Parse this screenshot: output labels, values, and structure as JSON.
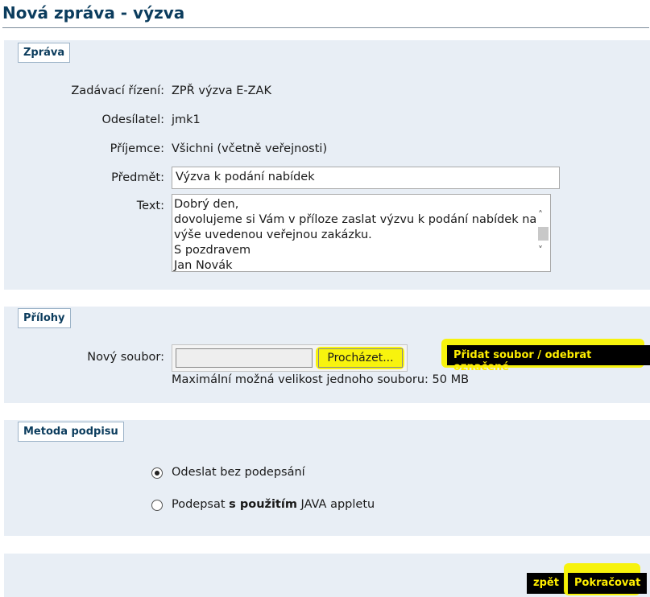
{
  "page": {
    "title": "Nová zpráva - výzva"
  },
  "message": {
    "legend": "Zpráva",
    "procedure_label": "Zadávací řízení:",
    "procedure_value": "ZPŘ výzva E-ZAK",
    "sender_label": "Odesílatel:",
    "sender_value": "jmk1",
    "recipient_label": "Příjemce:",
    "recipient_value": "Všichni (včetně veřejnosti)",
    "subject_label": "Předmět:",
    "subject_value": "Výzva k podání nabídek",
    "text_label": "Text:",
    "text_lines": [
      "Dobrý den,",
      "dovolujeme si Vám v příloze zaslat výzvu k podání nabídek na",
      "výše uvedenou veřejnou zakázku.",
      "S pozdravem",
      "Jan Novák"
    ]
  },
  "attachments": {
    "legend": "Přílohy",
    "new_file_label": "Nový soubor:",
    "browse_button": "Procházet...",
    "add_remove_button": "Přidat soubor / odebrat označené",
    "max_size_note": "Maximální možná velikost jednoho souboru: 50 MB"
  },
  "signature": {
    "legend": "Metoda podpisu",
    "option1": "Odeslat bez podepsání",
    "option2_prefix": "Podepsat ",
    "option2_bold": "s použitím",
    "option2_suffix": " JAVA appletu",
    "selected": "option1"
  },
  "footer": {
    "back_button": "zpět",
    "continue_button": "Pokračovat"
  },
  "colors": {
    "title": "#0b3c5d",
    "panel_bg": "#e8eef5",
    "button_bg": "#000000",
    "button_text": "#ffee00",
    "highlight": "#f8f200"
  }
}
